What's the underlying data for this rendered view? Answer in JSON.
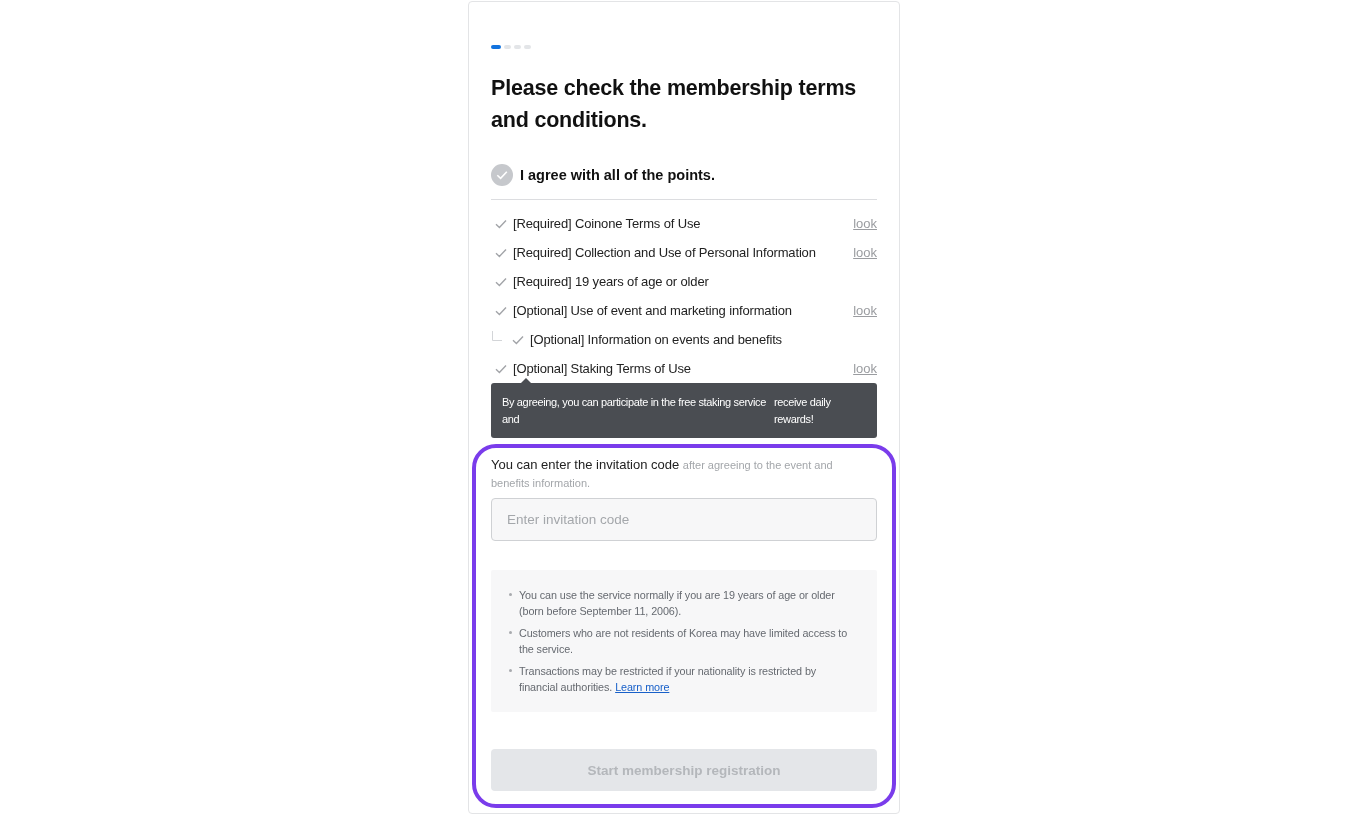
{
  "progress": {
    "steps": [
      {
        "active": true
      },
      {
        "active": false
      },
      {
        "active": false
      },
      {
        "active": false
      }
    ]
  },
  "title": "Please check the membership terms and conditions.",
  "agree_all": {
    "label": "I agree with all of the points.",
    "checked": false
  },
  "terms": [
    {
      "label": "[Required] Coinone Terms of Use",
      "link": "look"
    },
    {
      "label": "[Required] Collection and Use of Personal Information",
      "link": "look"
    },
    {
      "label": "[Required] 19 years of age or older"
    },
    {
      "label": "[Optional] Use of event and marketing information",
      "link": "look",
      "children": [
        {
          "label": "[Optional] Information on events and benefits"
        }
      ]
    },
    {
      "label": "[Optional] Staking Terms of Use",
      "link": "look",
      "tooltip": [
        "By agreeing, you can participate in the free staking service and",
        "receive daily rewards!"
      ]
    }
  ],
  "registration": {
    "highlighted": true,
    "invitation": {
      "label": "You can enter the invitation code",
      "note": "after agreeing to the event and benefits information.",
      "field": {
        "placeholder": "Enter invitation code"
      }
    },
    "notices": [
      {
        "text": "You can use the service normally if you are 19 years of age or older (born before September 11, 2006)."
      },
      {
        "text": "Customers who are not residents of Korea may have limited access to the service."
      },
      {
        "text": "Transactions may be restricted if your nationality is restricted by financial authorities.",
        "link": "Learn more"
      }
    ],
    "submit_button": {
      "label": "Start membership registration",
      "disabled": true
    }
  }
}
